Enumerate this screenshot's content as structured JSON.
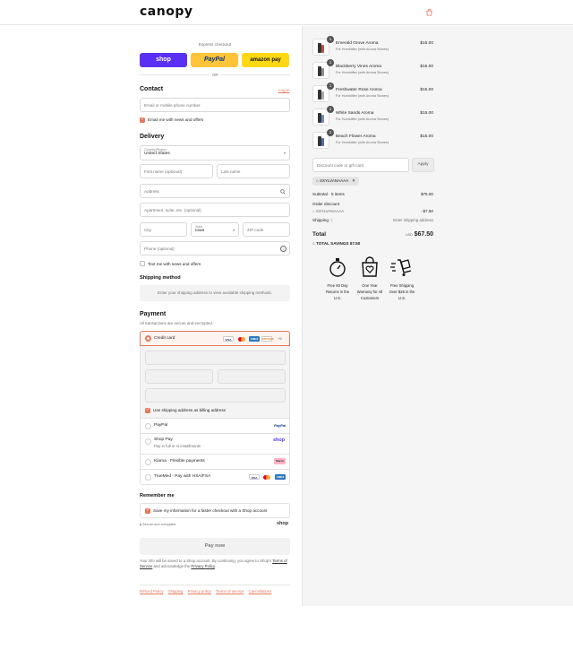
{
  "header": {
    "logo": "canopy",
    "cart_icon": "bag-icon"
  },
  "express": {
    "title": "Express checkout",
    "shop_label": "shop",
    "paypal_label": "PayPal",
    "amazon_label": "amazon pay",
    "or": "OR"
  },
  "contact": {
    "title": "Contact",
    "login": "Log in",
    "phone_placeholder": "Email or mobile phone number",
    "news_label": "Email me with news and offers"
  },
  "delivery": {
    "title": "Delivery",
    "country_label": "Country/Region",
    "country_value": "United States",
    "first_name": "First name (optional)",
    "last_name": "Last name",
    "address": "Address",
    "apartment": "Apartment, suite, etc. (optional)",
    "city": "City",
    "state_label": "State",
    "state_value": "Iowa",
    "zip": "ZIP code",
    "phone": "Phone (optional)",
    "text_news": "Text me with news and offers"
  },
  "shipping_method": {
    "title": "Shipping method",
    "message": "Enter your shipping address to view available shipping methods."
  },
  "payment": {
    "title": "Payment",
    "subtitle": "All transactions are secure and encrypted.",
    "credit_card": "Credit card",
    "more_cards": "+5",
    "billing_same": "Use shipping address as billing address",
    "paypal": "PayPal",
    "shop_pay": "Shop Pay",
    "shop_pay_sub": "Pay in full or in installments",
    "klarna": "Klarna - Flexible payments",
    "trustmed": "TrueMed - Pay with HSA/FSA",
    "card_brands": [
      "VISA",
      "MC",
      "AMEX",
      "DISCOVER"
    ]
  },
  "remember": {
    "title": "Remember me",
    "save_label": "Save my information for a faster checkout with a Shop account",
    "secure": "Secure and encrypted",
    "shop": "shop"
  },
  "pay_now": "Pay now",
  "legal": {
    "prefix": "Your info will be saved to a Shop account. By continuing, you agree to Shop's",
    "terms": "Terms of Service",
    "mid": "and acknowledge the",
    "privacy": "Privacy Policy",
    "end": "."
  },
  "footer_links": [
    "Refund Policy",
    "Shipping",
    "Privacy policy",
    "Terms of service",
    "Cancellations"
  ],
  "cart": {
    "items": [
      {
        "name": "Emerald Grove Aroma",
        "sub": "For Humidifier (with Aroma Stones)",
        "qty": "1",
        "price": "$15.00",
        "color": "#b5563f"
      },
      {
        "name": "Blackberry Vines Aroma",
        "sub": "For Humidifier (with Aroma Stones)",
        "qty": "1",
        "price": "$15.00",
        "color": "#8a8d8f"
      },
      {
        "name": "Freshwater Rose Aroma",
        "sub": "For Humidifier (with Aroma Stones)",
        "qty": "1",
        "price": "$15.00",
        "color": "#a7a9ab"
      },
      {
        "name": "White Sands Aroma",
        "sub": "For Humidifier (with Aroma Stones)",
        "qty": "1",
        "price": "$15.00",
        "color": "#6d8fb5"
      },
      {
        "name": "Beach Flower Aroma",
        "sub": "For Humidifier (with Aroma Stones)",
        "qty": "1",
        "price": "$15.00",
        "color": "#4c6ea3"
      }
    ],
    "discount_placeholder": "Discount code or gift card",
    "apply": "Apply",
    "code_tag": "SSYLVANAAAA",
    "subtotal_label": "Subtotal · 5 items",
    "subtotal": "$75.00",
    "order_discount_label": "Order discount",
    "discount_code": "SSYLVANAAAA",
    "discount_value": "- $7.50",
    "shipping_label": "Shipping",
    "shipping_value": "Enter shipping address",
    "total_label": "Total",
    "currency": "USD",
    "total": "$67.50",
    "savings_label": "TOTAL SAVINGS",
    "savings": "$7.50"
  },
  "perks": [
    {
      "icon": "stopwatch-icon",
      "line1": "Free 60 Day",
      "line2": "Returns in the",
      "line3": "U.S."
    },
    {
      "icon": "heart-bag-icon",
      "line1": "One Year",
      "line2": "Warranty for All",
      "line3": "Customers"
    },
    {
      "icon": "delivery-cart-icon",
      "line1": "Free Shipping",
      "line2": "Over $25 in the",
      "line3": "U.S."
    }
  ]
}
